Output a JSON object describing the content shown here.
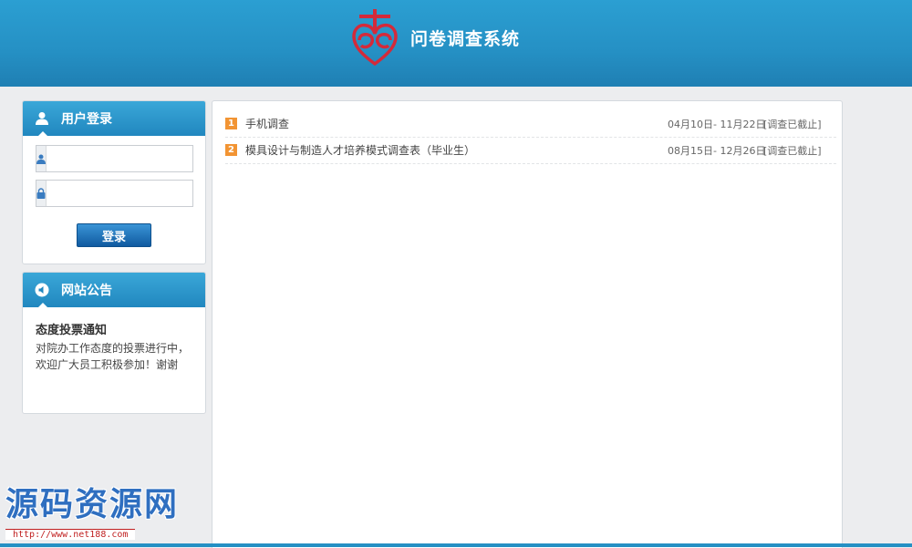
{
  "header": {
    "site_title": "问卷调查系统",
    "logo_icon": "heart-knot-logo-icon",
    "colors": {
      "header_bg": "#2590c4",
      "logo_red": "#d42a3a"
    }
  },
  "login": {
    "title": "用户登录",
    "icon": "user-icon",
    "username_placeholder": "",
    "password_placeholder": "",
    "submit_label": "登录"
  },
  "notice": {
    "title": "网站公告",
    "icon": "speaker-icon",
    "heading": "态度投票通知",
    "body": "对院办工作态度的投票进行中，欢迎广大员工积极参加！谢谢"
  },
  "surveys": [
    {
      "num": "1",
      "title": "手机调查",
      "date": "04月10日- 11月22日",
      "status": "[调查已截止]"
    },
    {
      "num": "2",
      "title": "模具设计与制造人才培养模式调查表（毕业生）",
      "date": "08月15日- 12月26日",
      "status": "[调查已截止]"
    }
  ],
  "watermark": {
    "text": "源码资源网",
    "url": "http://www.net188.com"
  }
}
